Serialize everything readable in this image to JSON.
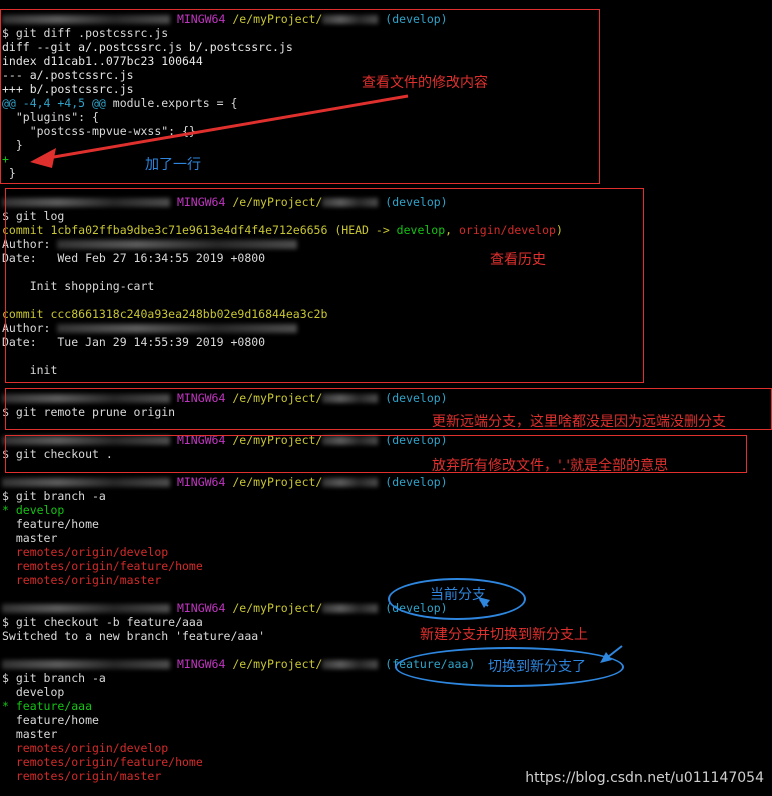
{
  "prompt": {
    "host_suffix": "MINGW64",
    "path_prefix": "/e/myProject/",
    "branch_develop": "(develop)",
    "branch_aaa": "(feature/aaa)"
  },
  "block1": {
    "cmd": "$ git diff .postcssrc.js",
    "lines": [
      "diff --git a/.postcssrc.js b/.postcssrc.js",
      "index d11cab1..077bc23 100644",
      "--- a/.postcssrc.js",
      "+++ b/.postcssrc.js"
    ],
    "hunk": "@@ -4,4 +4,5 @@",
    "hunk_ctx": " module.exports = {",
    "code": [
      "  \"plugins\": {",
      "    \"postcss-mpvue-wxss\": {}",
      "  }",
      "+",
      " }"
    ],
    "note_view_diff": "查看文件的修改内容",
    "note_added_line": "加了一行"
  },
  "block2": {
    "cmd": "$ git log",
    "commit1": "commit 1cbfa02ffba9dbe3c71e9613e4df4f4e712e6656",
    "head": "(HEAD -> ",
    "develop": "develop",
    "sep": ", ",
    "origin": "origin/develop",
    "close": ")",
    "author": "Author:",
    "date1": "Date:   Wed Feb 27 16:34:55 2019 +0800",
    "msg1": "    Init shopping-cart",
    "commit2": "commit ccc8661318c240a93ea248bb02e9d16844ea3c2b",
    "date2": "Date:   Tue Jan 29 14:55:39 2019 +0800",
    "msg2": "    init",
    "note_history": "查看历史"
  },
  "block3": {
    "cmd": "$ git remote prune origin",
    "note": "更新远端分支，这里啥都没是因为远端没删分支"
  },
  "block4": {
    "cmd": "$ git checkout .",
    "note": "放弃所有修改文件，'.'就是全部的意思"
  },
  "block5": {
    "cmd": "$ git branch -a",
    "current": "* develop",
    "others": [
      "  feature/home",
      "  master"
    ],
    "remotes": [
      "  remotes/origin/develop",
      "  remotes/origin/feature/home",
      "  remotes/origin/master"
    ]
  },
  "block6": {
    "cmd": "$ git checkout -b feature/aaa",
    "out": "Switched to a new branch 'feature/aaa'",
    "note_current": "当前分支",
    "note_new_branch": "新建分支并切换到新分支上"
  },
  "block7": {
    "cmd": "$ git branch -a",
    "plain1": "  develop",
    "current": "* feature/aaa",
    "others": [
      "  feature/home",
      "  master"
    ],
    "remotes": [
      "  remotes/origin/develop",
      "  remotes/origin/feature/home",
      "  remotes/origin/master"
    ],
    "note_switched": "切换到新分支了"
  },
  "watermark": "https://blog.csdn.net/u011147054",
  "colors": {
    "green": "#13c413",
    "magenta": "#c035c0",
    "yellow": "#c8c632",
    "cyan": "#2fa3c9",
    "red": "#d32a2a",
    "annotation_red": "#e0302e",
    "annotation_blue": "#2e86de"
  }
}
